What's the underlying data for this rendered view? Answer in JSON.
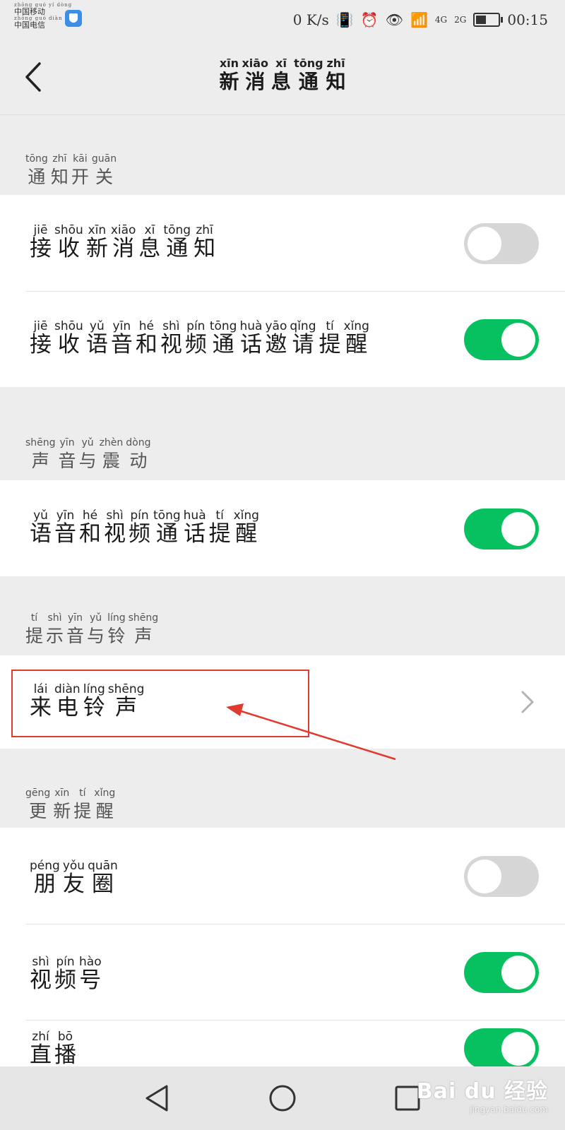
{
  "status_bar": {
    "carrier1_py": "zhōng guó  yí  dòng",
    "carrier1": "中国移动",
    "carrier2_py": "zhōng guó diàn  xìn",
    "carrier2": "中国电信",
    "net_speed": "0 K/s",
    "signal1": "4G",
    "signal2": "2G",
    "time": "00:15"
  },
  "header": {
    "title": [
      {
        "p": "xīn",
        "h": "新"
      },
      {
        "p": "xiāo",
        "h": "消"
      },
      {
        "p": "xī",
        "h": "息"
      },
      {
        "p": "tōng",
        "h": "通"
      },
      {
        "p": "zhī",
        "h": "知"
      }
    ]
  },
  "sections": {
    "notify_switch": [
      {
        "p": "tōng",
        "h": "通"
      },
      {
        "p": "zhī",
        "h": "知"
      },
      {
        "p": "kāi",
        "h": "开"
      },
      {
        "p": "guān",
        "h": "关"
      }
    ],
    "sound_vibration": [
      {
        "p": "shēng",
        "h": "声"
      },
      {
        "p": "yīn",
        "h": "音"
      },
      {
        "p": "yǔ",
        "h": "与"
      },
      {
        "p": "zhèn",
        "h": "震"
      },
      {
        "p": "dòng",
        "h": "动"
      }
    ],
    "tone_ringtone": [
      {
        "p": "tí",
        "h": "提"
      },
      {
        "p": "shì",
        "h": "示"
      },
      {
        "p": "yīn",
        "h": "音"
      },
      {
        "p": "yǔ",
        "h": "与"
      },
      {
        "p": "líng",
        "h": "铃"
      },
      {
        "p": "shēng",
        "h": "声"
      }
    ],
    "update_reminder": [
      {
        "p": "gēng",
        "h": "更"
      },
      {
        "p": "xīn",
        "h": "新"
      },
      {
        "p": "tí",
        "h": "提"
      },
      {
        "p": "xǐng",
        "h": "醒"
      }
    ]
  },
  "rows": {
    "receive_new": {
      "label": [
        {
          "p": "jiē",
          "h": "接"
        },
        {
          "p": "shōu",
          "h": "收"
        },
        {
          "p": "xīn",
          "h": "新"
        },
        {
          "p": "xiāo",
          "h": "消"
        },
        {
          "p": "xī",
          "h": "息"
        },
        {
          "p": "tōng",
          "h": "通"
        },
        {
          "p": "zhī",
          "h": "知"
        }
      ],
      "enabled": false
    },
    "receive_call": {
      "label": [
        {
          "p": "jiē",
          "h": "接"
        },
        {
          "p": "shōu",
          "h": "收"
        },
        {
          "p": "yǔ",
          "h": "语"
        },
        {
          "p": "yīn",
          "h": "音"
        },
        {
          "p": "hé",
          "h": "和"
        },
        {
          "p": "shì",
          "h": "视"
        },
        {
          "p": "pín",
          "h": "频"
        },
        {
          "p": "tōng",
          "h": "通"
        },
        {
          "p": "huà",
          "h": "话"
        },
        {
          "p": "yāo",
          "h": "邀"
        },
        {
          "p": "qǐng",
          "h": "请"
        },
        {
          "p": "tí",
          "h": "提"
        },
        {
          "p": "xǐng",
          "h": "醒"
        }
      ],
      "enabled": true
    },
    "call_alert": {
      "label": [
        {
          "p": "yǔ",
          "h": "语"
        },
        {
          "p": "yīn",
          "h": "音"
        },
        {
          "p": "hé",
          "h": "和"
        },
        {
          "p": "shì",
          "h": "视"
        },
        {
          "p": "pín",
          "h": "频"
        },
        {
          "p": "tōng",
          "h": "通"
        },
        {
          "p": "huà",
          "h": "话"
        },
        {
          "p": "tí",
          "h": "提"
        },
        {
          "p": "xǐng",
          "h": "醒"
        }
      ],
      "enabled": true
    },
    "ringtone": {
      "label": [
        {
          "p": "lái",
          "h": "来"
        },
        {
          "p": "diàn",
          "h": "电"
        },
        {
          "p": "líng",
          "h": "铃"
        },
        {
          "p": "shēng",
          "h": "声"
        }
      ]
    },
    "moments": {
      "label": [
        {
          "p": "péng",
          "h": "朋"
        },
        {
          "p": "yǒu",
          "h": "友"
        },
        {
          "p": "quān",
          "h": "圈"
        }
      ],
      "enabled": false
    },
    "channels": {
      "label": [
        {
          "p": "shì",
          "h": "视"
        },
        {
          "p": "pín",
          "h": "频"
        },
        {
          "p": "hào",
          "h": "号"
        }
      ],
      "enabled": true
    },
    "live": {
      "label": [
        {
          "p": "zhí",
          "h": "直"
        },
        {
          "p": "bō",
          "h": "播"
        }
      ],
      "enabled": true
    }
  },
  "watermark": {
    "line1": "Bai du 经验",
    "line2": "jingyan.baidu.com"
  },
  "colors": {
    "accent": "#07c160",
    "toggle_off": "#d6d6d6",
    "highlight": "#e03a2e"
  }
}
